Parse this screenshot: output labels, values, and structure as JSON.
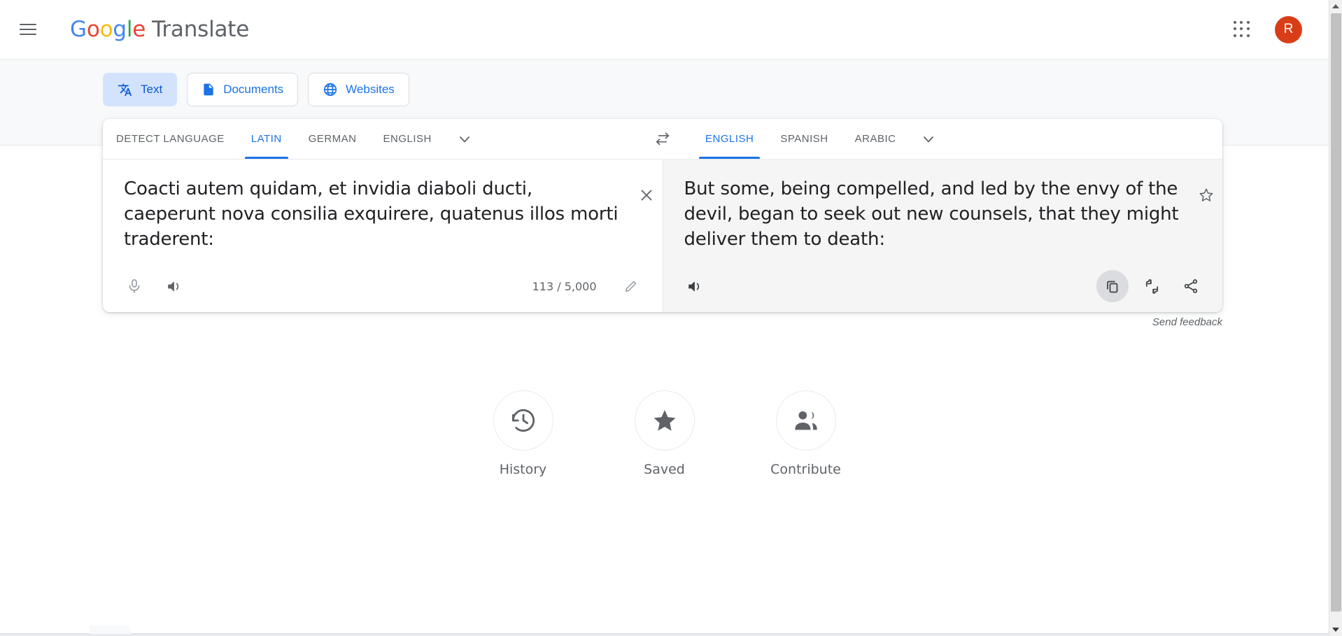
{
  "header": {
    "menu_icon": "hamburger-menu-icon",
    "brand_google": "Google",
    "brand_product": "Translate",
    "apps_icon": "apps-grid-icon",
    "avatar_initial": "R",
    "avatar_color": "#d93d18"
  },
  "modes": [
    {
      "label": "Text",
      "icon": "translate-icon",
      "active": true
    },
    {
      "label": "Documents",
      "icon": "document-icon",
      "active": false
    },
    {
      "label": "Websites",
      "icon": "globe-icon",
      "active": false
    }
  ],
  "source": {
    "languages": [
      "DETECT LANGUAGE",
      "LATIN",
      "GERMAN",
      "ENGLISH"
    ],
    "selected": "LATIN",
    "more_icon": "chevron-down-icon",
    "text": "Coacti autem quidam, et invidia diaboli ducti, caeperunt nova consilia exquirere, quatenus illos morti traderent:",
    "clear_icon": "close-icon",
    "mic_icon": "microphone-icon",
    "speaker_icon": "speaker-icon",
    "counter": "113 / 5,000",
    "edit_icon": "pencil-icon"
  },
  "swap": {
    "icon": "swap-languages-icon"
  },
  "target": {
    "languages": [
      "ENGLISH",
      "SPANISH",
      "ARABIC"
    ],
    "selected": "ENGLISH",
    "more_icon": "chevron-down-icon",
    "text": "But some, being compelled, and led by the envy of the devil, began to seek out new counsels, that they might deliver them to death:",
    "star_icon": "star-outline-icon",
    "speaker_icon": "speaker-icon",
    "copy_icon": "copy-icon",
    "feedback_icon": "thumbs-up-down-icon",
    "share_icon": "share-icon"
  },
  "feedback_link": "Send feedback",
  "shortcuts": [
    {
      "label": "History",
      "icon": "history-clock-icon"
    },
    {
      "label": "Saved",
      "icon": "star-filled-icon"
    },
    {
      "label": "Contribute",
      "icon": "people-group-icon"
    }
  ],
  "scrollbar": {
    "up_icon": "scroll-up-arrow-icon",
    "down_icon": "scroll-down-arrow-icon"
  },
  "colors": {
    "accent": "#1a73e8",
    "active_tab_bg": "#d3e3fd",
    "target_pane_bg": "#f5f5f5",
    "band_bg": "#f8f9fa"
  }
}
